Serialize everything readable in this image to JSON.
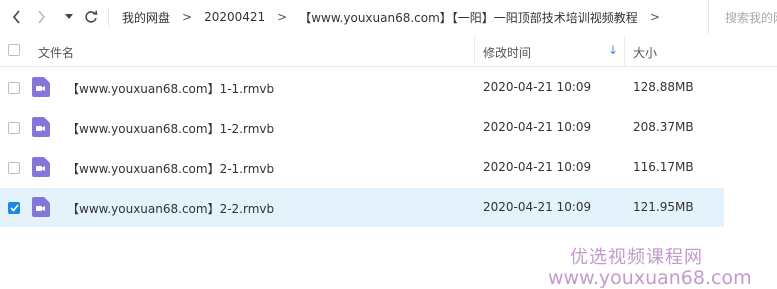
{
  "toolbar": {
    "icons": [
      "chevron-left-icon",
      "chevron-right-icon",
      "dropdown-icon",
      "refresh-icon"
    ],
    "breadcrumb": [
      "我的网盘",
      "20200421",
      "【www.youxuan68.com】【一阳】一阳顶部技术培训视频教程"
    ],
    "crumb_arrow": ">",
    "search_placeholder": "搜索我的网"
  },
  "header": {
    "name_label": "文件名",
    "time_label": "修改时间",
    "size_label": "大小",
    "sort_icon": "↓"
  },
  "files": [
    {
      "name": "【www.youxuan68.com】1-1.rmvb",
      "modified": "2020-04-21 10:09",
      "size": "128.88MB",
      "selected": false
    },
    {
      "name": "【www.youxuan68.com】1-2.rmvb",
      "modified": "2020-04-21 10:09",
      "size": "208.37MB",
      "selected": false
    },
    {
      "name": "【www.youxuan68.com】2-1.rmvb",
      "modified": "2020-04-21 10:09",
      "size": "116.17MB",
      "selected": false
    },
    {
      "name": "【www.youxuan68.com】2-2.rmvb",
      "modified": "2020-04-21 10:09",
      "size": "121.95MB",
      "selected": true
    }
  ],
  "file_icon": "video-file-icon",
  "watermark": {
    "line1": "优选视频课程网",
    "line2": "www.youxuan68.com"
  },
  "colors": {
    "accent": "#1e88e5",
    "selected_row": "#e3f2fb",
    "video_icon": "#8577d9",
    "watermark": "#c39acb"
  }
}
